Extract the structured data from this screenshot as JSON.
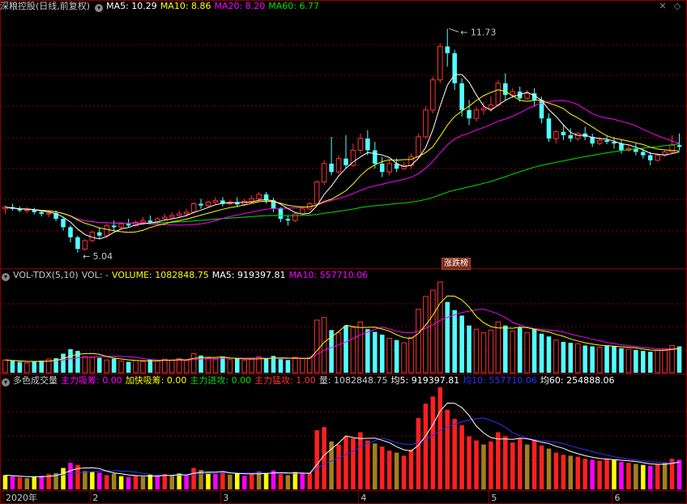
{
  "header": {
    "stock": "深粮控股(日线,前复权)",
    "ma5": "MA5: 10.29",
    "ma10": "MA10: 8.86",
    "ma20": "MA20: 8.20",
    "ma60": "MA60: 6.77",
    "btn_close": "✕",
    "btn_diamond": "◇"
  },
  "vol_header": {
    "name": "VOL-TDX(5,10)",
    "vol": "VOL: -",
    "volume": "VOLUME: 1082848.75",
    "ma5": "MA5: 919397.81",
    "ma10": "MA10: 557710.06"
  },
  "color_vol_header": {
    "name": "多色成交量",
    "s1": "主力吸筹: 0.00",
    "s2": "加快吸筹: 0.00",
    "s3": "主力进攻: 0.00",
    "s4": "主力猛攻: 1.00",
    "s5": "量: 1082848.75",
    "s6": "均5: 919397.81",
    "s7": "均10: 557710.06",
    "s8": "均60: 254888.06"
  },
  "badge": "涨跌榜",
  "colors": {
    "up": "#ff3232",
    "down": "#54ffff",
    "ma5": "#ffffff",
    "ma10": "#ffff00",
    "ma20": "#ff00ff",
    "ma60": "#00e000",
    "grid": "#8b0000"
  },
  "chart_data": [
    {
      "type": "candlestick",
      "title": "深粮控股(日线,前复权)",
      "annotations": [
        {
          "label": "11.73",
          "kind": "high"
        },
        {
          "label": "5.04",
          "kind": "low"
        }
      ],
      "x_labels": [
        "2020年",
        "2",
        "3",
        "4",
        "5",
        "6"
      ],
      "x_label_days": [
        0,
        12,
        30,
        49,
        67,
        84
      ],
      "ylim": [
        4.6,
        12.2
      ],
      "grid": true,
      "candles": [
        [
          6.35,
          6.45,
          6.4,
          6.2
        ],
        [
          6.4,
          6.5,
          6.35,
          6.3
        ],
        [
          6.35,
          6.42,
          6.3,
          6.25
        ],
        [
          6.3,
          6.4,
          6.32,
          6.22
        ],
        [
          6.32,
          6.38,
          6.25,
          6.18
        ],
        [
          6.25,
          6.3,
          6.2,
          6.12
        ],
        [
          6.2,
          6.28,
          6.22,
          6.1
        ],
        [
          6.22,
          6.3,
          6.05,
          5.98
        ],
        [
          6.05,
          6.1,
          5.8,
          5.7
        ],
        [
          5.8,
          5.85,
          5.5,
          5.35
        ],
        [
          5.5,
          5.55,
          5.15,
          5.04
        ],
        [
          5.15,
          5.45,
          5.4,
          5.1
        ],
        [
          5.4,
          5.7,
          5.65,
          5.35
        ],
        [
          5.65,
          5.8,
          5.55,
          5.45
        ],
        [
          5.55,
          5.9,
          5.85,
          5.5
        ],
        [
          5.85,
          6.0,
          5.8,
          5.7
        ],
        [
          5.8,
          5.95,
          5.9,
          5.75
        ],
        [
          5.9,
          6.05,
          5.85,
          5.8
        ],
        [
          5.85,
          6.0,
          5.95,
          5.82
        ],
        [
          5.95,
          6.1,
          6.0,
          5.9
        ],
        [
          6.0,
          6.15,
          5.95,
          5.88
        ],
        [
          5.95,
          6.1,
          6.05,
          5.9
        ],
        [
          6.05,
          6.2,
          6.1,
          6.0
        ],
        [
          6.1,
          6.25,
          6.15,
          6.05
        ],
        [
          6.15,
          6.3,
          6.2,
          6.08
        ],
        [
          6.2,
          6.35,
          6.25,
          6.12
        ],
        [
          6.25,
          6.55,
          6.5,
          6.2
        ],
        [
          6.5,
          6.65,
          6.45,
          6.35
        ],
        [
          6.45,
          6.6,
          6.55,
          6.4
        ],
        [
          6.55,
          6.7,
          6.6,
          6.48
        ],
        [
          6.6,
          6.7,
          6.5,
          6.42
        ],
        [
          6.5,
          6.62,
          6.55,
          6.45
        ],
        [
          6.55,
          6.7,
          6.48,
          6.4
        ],
        [
          6.48,
          6.65,
          6.58,
          6.42
        ],
        [
          6.58,
          6.75,
          6.65,
          6.5
        ],
        [
          6.65,
          6.85,
          6.78,
          6.55
        ],
        [
          6.78,
          6.85,
          6.6,
          6.5
        ],
        [
          6.6,
          6.68,
          6.35,
          6.25
        ],
        [
          6.35,
          6.4,
          6.05,
          5.95
        ],
        [
          6.05,
          6.15,
          6.0,
          5.85
        ],
        [
          6.0,
          6.25,
          6.2,
          5.95
        ],
        [
          6.2,
          6.4,
          6.35,
          6.15
        ],
        [
          6.35,
          6.55,
          6.5,
          6.3
        ],
        [
          6.5,
          7.2,
          7.15,
          6.45
        ],
        [
          7.15,
          7.8,
          7.7,
          7.05
        ],
        [
          7.7,
          8.5,
          7.45,
          7.35
        ],
        [
          7.45,
          7.95,
          7.85,
          7.4
        ],
        [
          7.85,
          8.55,
          7.65,
          7.55
        ],
        [
          7.65,
          8.3,
          8.1,
          7.6
        ],
        [
          8.1,
          8.6,
          8.45,
          8.0
        ],
        [
          8.45,
          8.7,
          8.1,
          7.95
        ],
        [
          8.1,
          8.35,
          7.7,
          7.55
        ],
        [
          7.7,
          7.9,
          7.45,
          7.3
        ],
        [
          7.45,
          7.8,
          7.7,
          7.35
        ],
        [
          7.7,
          7.85,
          7.55,
          7.45
        ],
        [
          7.55,
          7.75,
          7.65,
          7.5
        ],
        [
          7.65,
          8.0,
          7.9,
          7.55
        ],
        [
          7.9,
          8.6,
          8.5,
          7.85
        ],
        [
          8.5,
          9.4,
          9.3,
          8.45
        ],
        [
          9.3,
          10.3,
          10.2,
          9.2
        ],
        [
          10.2,
          11.3,
          11.2,
          10.1
        ],
        [
          11.2,
          11.73,
          11.0,
          10.6
        ],
        [
          11.0,
          11.1,
          10.1,
          9.9
        ],
        [
          10.1,
          10.25,
          9.3,
          9.1
        ],
        [
          9.3,
          9.6,
          9.05,
          8.85
        ],
        [
          9.05,
          9.4,
          9.3,
          8.95
        ],
        [
          9.3,
          9.55,
          9.35,
          9.15
        ],
        [
          9.35,
          9.7,
          9.45,
          9.25
        ],
        [
          9.45,
          10.2,
          10.1,
          9.4
        ],
        [
          10.1,
          10.4,
          9.75,
          9.6
        ],
        [
          9.75,
          9.95,
          9.85,
          9.65
        ],
        [
          9.85,
          10.0,
          9.65,
          9.55
        ],
        [
          9.65,
          9.9,
          9.8,
          9.6
        ],
        [
          9.8,
          9.95,
          9.6,
          9.4
        ],
        [
          9.6,
          9.7,
          9.05,
          8.9
        ],
        [
          9.05,
          9.2,
          8.45,
          8.35
        ],
        [
          8.45,
          8.7,
          8.65,
          8.3
        ],
        [
          8.65,
          8.85,
          8.55,
          8.4
        ],
        [
          8.55,
          8.75,
          8.45,
          8.35
        ],
        [
          8.45,
          8.65,
          8.6,
          8.38
        ],
        [
          8.6,
          8.8,
          8.5,
          8.4
        ],
        [
          8.5,
          8.6,
          8.3,
          8.2
        ],
        [
          8.3,
          8.5,
          8.4,
          8.25
        ],
        [
          8.4,
          8.55,
          8.35,
          8.28
        ],
        [
          8.35,
          8.5,
          8.3,
          8.15
        ],
        [
          8.3,
          8.4,
          8.1,
          8.0
        ],
        [
          8.1,
          8.25,
          8.15,
          8.05
        ],
        [
          8.15,
          8.3,
          8.05,
          7.95
        ],
        [
          8.05,
          8.15,
          7.95,
          7.85
        ],
        [
          7.95,
          8.05,
          7.8,
          7.65
        ],
        [
          7.8,
          8.0,
          7.95,
          7.75
        ],
        [
          7.95,
          8.1,
          8.05,
          7.9
        ],
        [
          8.05,
          8.55,
          8.25,
          8.0
        ],
        [
          8.25,
          8.6,
          8.2,
          8.1
        ]
      ]
    },
    {
      "type": "bar",
      "title": "VOL-TDX(5,10)",
      "series": [
        {
          "name": "VOLUME",
          "values": []
        },
        {
          "name": "MA5"
        },
        {
          "name": "MA10"
        }
      ]
    },
    {
      "type": "bar",
      "title": "多色成交量",
      "series": [
        {
          "name": "主力吸筹"
        },
        {
          "name": "加快吸筹"
        },
        {
          "name": "主力进攻"
        },
        {
          "name": "主力猛攻"
        },
        {
          "name": "量"
        }
      ]
    }
  ],
  "volumes": [
    140,
    130,
    120,
    110,
    125,
    135,
    150,
    160,
    210,
    260,
    240,
    180,
    170,
    165,
    140,
    155,
    130,
    120,
    135,
    125,
    145,
    130,
    150,
    140,
    155,
    135,
    210,
    190,
    160,
    150,
    170,
    145,
    160,
    135,
    150,
    175,
    160,
    185,
    150,
    140,
    170,
    155,
    165,
    580,
    610,
    470,
    440,
    520,
    500,
    560,
    480,
    450,
    420,
    380,
    360,
    330,
    390,
    700,
    840,
    910,
    1000,
    780,
    690,
    630,
    520,
    480,
    440,
    470,
    560,
    520,
    460,
    500,
    440,
    480,
    430,
    400,
    360,
    340,
    330,
    320,
    300,
    290,
    280,
    300,
    290,
    270,
    260,
    250,
    240,
    230,
    250,
    260,
    300,
    290
  ],
  "vol_peak": 1000
}
